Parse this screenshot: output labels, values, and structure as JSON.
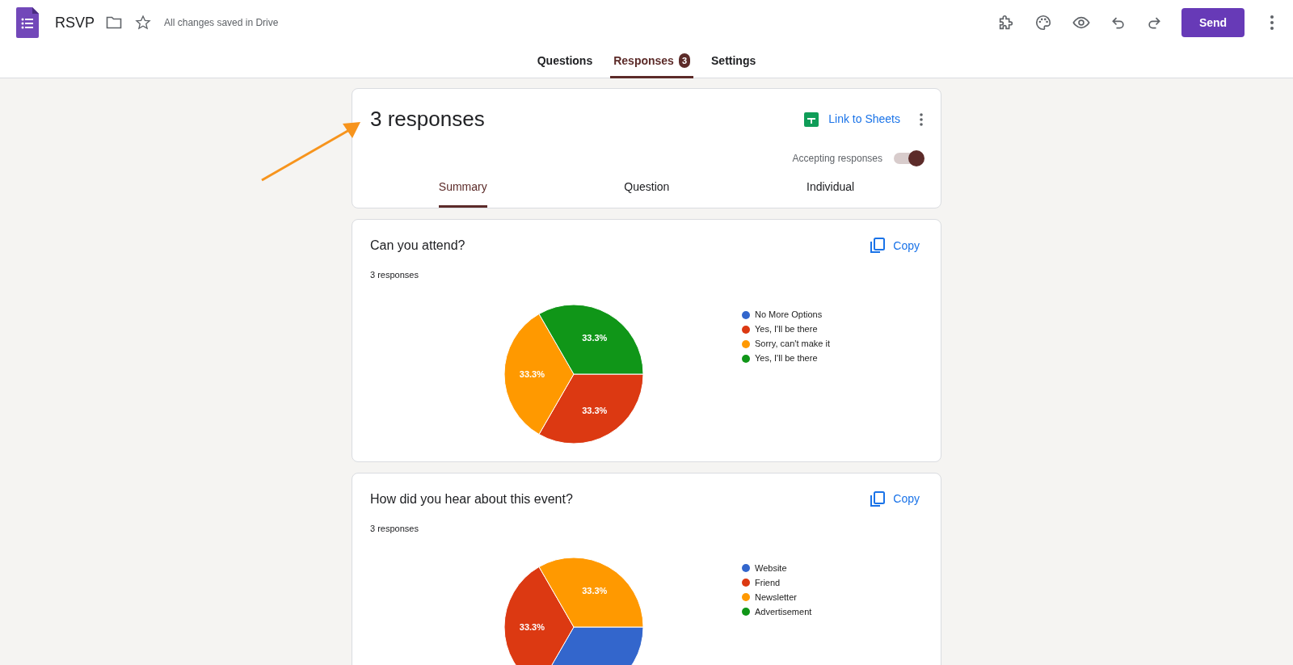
{
  "app": {
    "title": "RSVP",
    "save_status": "All changes saved in Drive",
    "send_label": "Send"
  },
  "tabs": [
    {
      "label": "Questions",
      "selected": false
    },
    {
      "label": "Responses",
      "selected": true,
      "badge": "3"
    },
    {
      "label": "Settings",
      "selected": false
    }
  ],
  "summary": {
    "title": "3 responses",
    "link_label": "Link to Sheets",
    "accepting": {
      "label": "Accepting responses",
      "on": true
    },
    "views": [
      {
        "label": "Summary",
        "selected": true
      },
      {
        "label": "Question",
        "selected": false
      },
      {
        "label": "Individual",
        "selected": false
      }
    ]
  },
  "questions": [
    {
      "title": "Can you attend?",
      "count": "3 responses",
      "copy_label": "Copy",
      "chart_data": {
        "type": "pie",
        "categories": [
          "No More Options",
          "Yes, I'll be there",
          "Sorry, can't make it",
          "Yes, I'll be there"
        ],
        "colors": [
          "#3366cc",
          "#dc3912",
          "#ff9900",
          "#109618"
        ],
        "values": [
          0,
          33.3,
          33.3,
          33.3
        ],
        "value_labels": [
          null,
          "33.3%",
          "33.3%",
          "33.3%"
        ]
      }
    },
    {
      "title": "How did you hear about this event?",
      "count": "3 responses",
      "copy_label": "Copy",
      "chart_data": {
        "type": "pie",
        "categories": [
          "Website",
          "Friend",
          "Newsletter",
          "Advertisement"
        ],
        "colors": [
          "#3366cc",
          "#dc3912",
          "#ff9900",
          "#109618"
        ],
        "values": [
          33.3,
          33.3,
          33.3,
          0
        ],
        "value_labels": [
          null,
          "33.3%",
          "33.3%",
          null
        ]
      }
    }
  ],
  "annotation": {
    "kind": "arrow"
  }
}
